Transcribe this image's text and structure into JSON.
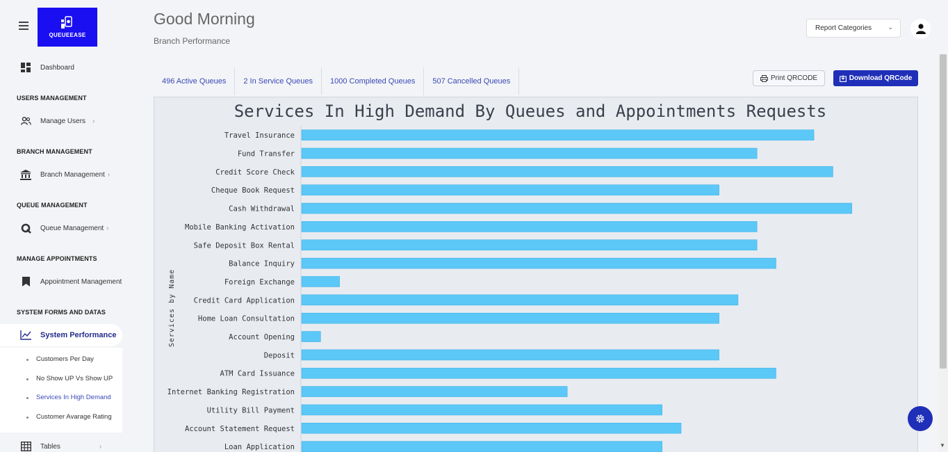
{
  "app": {
    "logo_text": "QUEUEEASE"
  },
  "header": {
    "greeting": "Good Morning",
    "subtitle": "Branch Performance",
    "report_select": "Report Categories"
  },
  "sidebar": {
    "dashboard": "Dashboard",
    "sections": {
      "users": "USERS MANAGEMENT",
      "branch": "BRANCH MANAGEMENT",
      "queue": "QUEUE MANAGEMENT",
      "appointments": "MANAGE APPOINTMENTS",
      "system": "SYSTEM FORMS AND DATAS"
    },
    "items": {
      "manage_users": "Manage Users",
      "branch_management": "Branch Management",
      "queue_management": "Queue Management",
      "appointment_management": "Appointment Management",
      "system_performance": "System Performance",
      "tables": "Tables"
    },
    "sub_items": [
      "Customers Per Day",
      "No Show UP Vs Show UP",
      "Services In High Demand",
      "Customer Avarage Rating"
    ]
  },
  "tabs": [
    "496 Active Queues",
    "2 In Service Queues",
    "1000 Completed Queues",
    "507 Cancelled Queues"
  ],
  "buttons": {
    "print": "Print QRCODE",
    "download": "Download QRCode"
  },
  "colors": {
    "accent": "#1f2fb8",
    "bar": "#5bc8f7",
    "logo_bg": "#1a0ff0"
  },
  "chart_data": {
    "type": "bar",
    "orientation": "horizontal",
    "title": "Services In High Demand By Queues and Appointments Requests",
    "ylabel": "Services by Name",
    "xlabel": "",
    "categories": [
      "Travel Insurance",
      "Fund Transfer",
      "Credit Score Check",
      "Cheque Book Request",
      "Cash Withdrawal",
      "Mobile Banking Activation",
      "Safe Deposit Box Rental",
      "Balance Inquiry",
      "Foreign Exchange",
      "Credit Card Application",
      "Home Loan Consultation",
      "Account Opening",
      "Deposit",
      "ATM Card Issuance",
      "Internet Banking Registration",
      "Utility Bill Payment",
      "Account Statement Request",
      "Loan Application"
    ],
    "values": [
      27,
      24,
      28,
      22,
      29,
      24,
      24,
      25,
      2,
      23,
      22,
      1,
      22,
      25,
      14,
      19,
      20,
      19
    ],
    "xlim": [
      0,
      30
    ],
    "grid": false,
    "legend": "none"
  }
}
